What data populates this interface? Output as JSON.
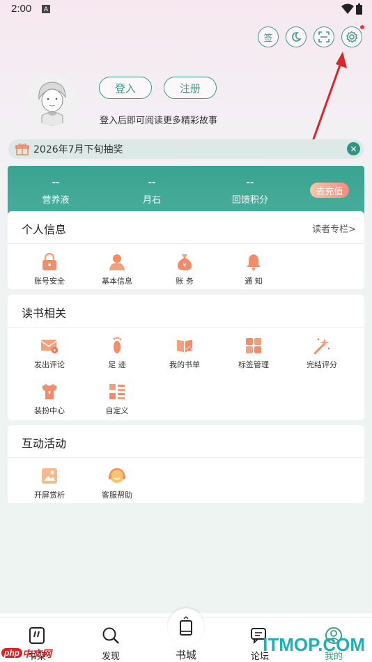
{
  "status": {
    "time": "2:00",
    "notif": "A"
  },
  "top_actions": {
    "sign_label": "签"
  },
  "profile": {
    "login_label": "登入",
    "register_label": "注册",
    "hint": "登入后即可阅读更多精彩故事"
  },
  "lottery": {
    "text": "2026年7月下旬抽奖",
    "close": "✕"
  },
  "stats": {
    "items": [
      {
        "value": "--",
        "label": "营养液"
      },
      {
        "value": "--",
        "label": "月石"
      },
      {
        "value": "--",
        "label": "回馈积分"
      }
    ],
    "recharge_label": "去充值"
  },
  "personal": {
    "title": "个人信息",
    "link": "读者专栏>",
    "items": [
      {
        "label": "账号安全",
        "icon": "lock-icon"
      },
      {
        "label": "基本信息",
        "icon": "person-icon"
      },
      {
        "label": "账 务",
        "icon": "money-bag-icon"
      },
      {
        "label": "通 知",
        "icon": "bell-icon"
      }
    ]
  },
  "reading": {
    "title": "读书相关",
    "items": [
      {
        "label": "发出评论",
        "icon": "mail-icon"
      },
      {
        "label": "足 迹",
        "icon": "footprint-icon"
      },
      {
        "label": "我的书单",
        "icon": "booklist-icon"
      },
      {
        "label": "标签管理",
        "icon": "grid-icon"
      },
      {
        "label": "完结评分",
        "icon": "magic-wand-icon"
      },
      {
        "label": "装扮中心",
        "icon": "shirt-icon"
      },
      {
        "label": "自定义",
        "icon": "list-icon"
      }
    ]
  },
  "activity": {
    "title": "互动活动",
    "items": [
      {
        "label": "开屏赏析",
        "icon": "image-icon"
      },
      {
        "label": "客服帮助",
        "icon": "support-icon"
      }
    ]
  },
  "nav": {
    "items": [
      {
        "label": "书架"
      },
      {
        "label": "发现"
      },
      {
        "label": "书城"
      },
      {
        "label": "论坛"
      },
      {
        "label": "我的"
      }
    ]
  },
  "watermark": {
    "site": "ITMOP.COM",
    "php": "php",
    "cn": "中文网"
  },
  "colors": {
    "accent": "#3d9a8a",
    "icon_orange": "#f58a63",
    "badge_red": "#e23a3a"
  }
}
